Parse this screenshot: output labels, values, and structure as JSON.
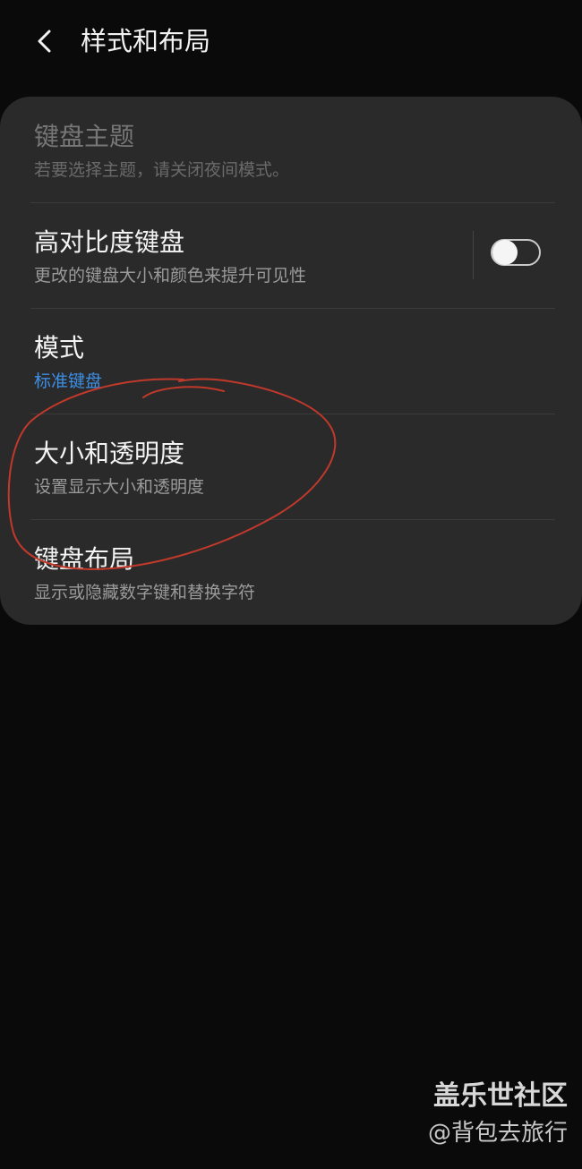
{
  "header": {
    "back_icon": "chevron-left-icon",
    "title": "样式和布局"
  },
  "settings": {
    "items": [
      {
        "title": "键盘主题",
        "subtitle": "若要选择主题，请关闭夜间模式。",
        "enabled": false
      },
      {
        "title": "高对比度键盘",
        "subtitle": "更改的键盘大小和颜色来提升可见性",
        "toggle_on": false
      },
      {
        "title": "模式",
        "subtitle": "标准键盘"
      },
      {
        "title": "大小和透明度",
        "subtitle": "设置显示大小和透明度"
      },
      {
        "title": "键盘布局",
        "subtitle": "显示或隐藏数字键和替换字符"
      }
    ]
  },
  "watermark": {
    "brand": "盖乐世社区",
    "user": "@背包去旅行"
  },
  "colors": {
    "background": "#0a0a0a",
    "card": "#2a2a2a",
    "accent": "#3d8fe6",
    "annotation": "#c0392b"
  }
}
